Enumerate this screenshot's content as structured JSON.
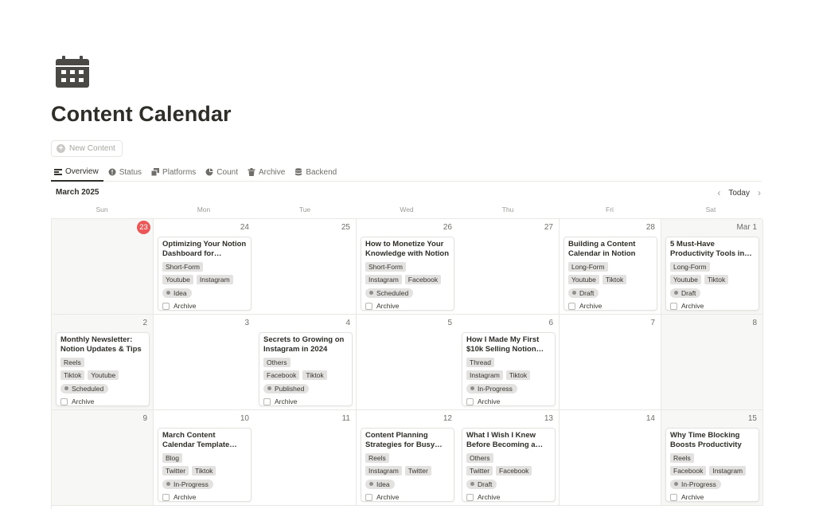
{
  "page": {
    "title": "Content Calendar",
    "icon": "calendar-icon"
  },
  "new_button": {
    "label": "New Content",
    "icon": "plus-circle-icon"
  },
  "tabs": [
    {
      "label": "Overview",
      "icon": "calendar-view-icon",
      "active": true
    },
    {
      "label": "Status",
      "icon": "alert-circle-icon",
      "active": false
    },
    {
      "label": "Platforms",
      "icon": "stack-icon",
      "active": false
    },
    {
      "label": "Count",
      "icon": "pie-chart-icon",
      "active": false
    },
    {
      "label": "Archive",
      "icon": "trash-icon",
      "active": false
    },
    {
      "label": "Backend",
      "icon": "database-icon",
      "active": false
    }
  ],
  "calendar": {
    "month_label": "March 2025",
    "today_label": "Today",
    "weekdays": [
      "Sun",
      "Mon",
      "Tue",
      "Wed",
      "Thu",
      "Fri",
      "Sat"
    ],
    "weeks": [
      {
        "days": [
          {
            "label": "23",
            "today": true,
            "card": null
          },
          {
            "label": "24",
            "card": {
              "title": "Optimizing Your Notion Dashboard for…",
              "format": "Short-Form",
              "platforms": [
                "Youtube",
                "Instagram"
              ],
              "status": "Idea",
              "archive": "Archive"
            }
          },
          {
            "label": "25",
            "card": null
          },
          {
            "label": "26",
            "card": {
              "title": "How to Monetize Your Knowledge with Notion",
              "format": "Short-Form",
              "platforms": [
                "Instagram",
                "Facebook"
              ],
              "status": "Scheduled",
              "archive": "Archive"
            }
          },
          {
            "label": "27",
            "card": null
          },
          {
            "label": "28",
            "card": {
              "title": "Building a Content Calendar in Notion",
              "format": "Long-Form",
              "platforms": [
                "Youtube",
                "Tiktok"
              ],
              "status": "Draft",
              "archive": "Archive"
            }
          },
          {
            "label": "Mar 1",
            "card": {
              "title": "5 Must-Have Productivity Tools in…",
              "format": "Long-Form",
              "platforms": [
                "Youtube",
                "Tiktok"
              ],
              "status": "Draft",
              "archive": "Archive"
            }
          }
        ]
      },
      {
        "days": [
          {
            "label": "2",
            "card": {
              "title": "Monthly Newsletter: Notion Updates & Tips",
              "format": "Reels",
              "platforms": [
                "Tiktok",
                "Youtube"
              ],
              "status": "Scheduled",
              "archive": "Archive"
            }
          },
          {
            "label": "3",
            "card": null
          },
          {
            "label": "4",
            "card": {
              "title": "Secrets to Growing on Instagram in 2024",
              "format": "Others",
              "platforms": [
                "Facebook",
                "Tiktok"
              ],
              "status": "Published",
              "archive": "Archive"
            }
          },
          {
            "label": "5",
            "card": null
          },
          {
            "label": "6",
            "card": {
              "title": "How I Made My First $10k Selling Notion…",
              "format": "Thread",
              "platforms": [
                "Instagram",
                "Tiktok"
              ],
              "status": "In-Progress",
              "archive": "Archive"
            }
          },
          {
            "label": "7",
            "card": null
          },
          {
            "label": "8",
            "card": null
          }
        ]
      },
      {
        "days": [
          {
            "label": "9",
            "card": null
          },
          {
            "label": "10",
            "card": {
              "title": "March Content Calendar Template…",
              "format": "Blog",
              "platforms": [
                "Twitter",
                "Tiktok"
              ],
              "status": "In-Progress",
              "archive": "Archive"
            }
          },
          {
            "label": "11",
            "card": null
          },
          {
            "label": "12",
            "card": {
              "title": "Content Planning Strategies for Busy…",
              "format": "Reels",
              "platforms": [
                "Instagram",
                "Twitter"
              ],
              "status": "Idea",
              "archive": "Archive"
            }
          },
          {
            "label": "13",
            "card": {
              "title": "What I Wish I Knew Before Becoming a…",
              "format": "Others",
              "platforms": [
                "Twitter",
                "Facebook"
              ],
              "status": "Draft",
              "archive": "Archive"
            }
          },
          {
            "label": "14",
            "card": null
          },
          {
            "label": "15",
            "card": {
              "title": "Why Time Blocking Boosts Productivity",
              "format": "Reels",
              "platforms": [
                "Facebook",
                "Instagram"
              ],
              "status": "In-Progress",
              "archive": "Archive"
            }
          }
        ]
      }
    ]
  },
  "colors": {
    "today_badge": "#eb5757",
    "tag_bg": "#e3e2e0",
    "weekend_bg": "#f7f7f5",
    "text": "#37352f"
  }
}
